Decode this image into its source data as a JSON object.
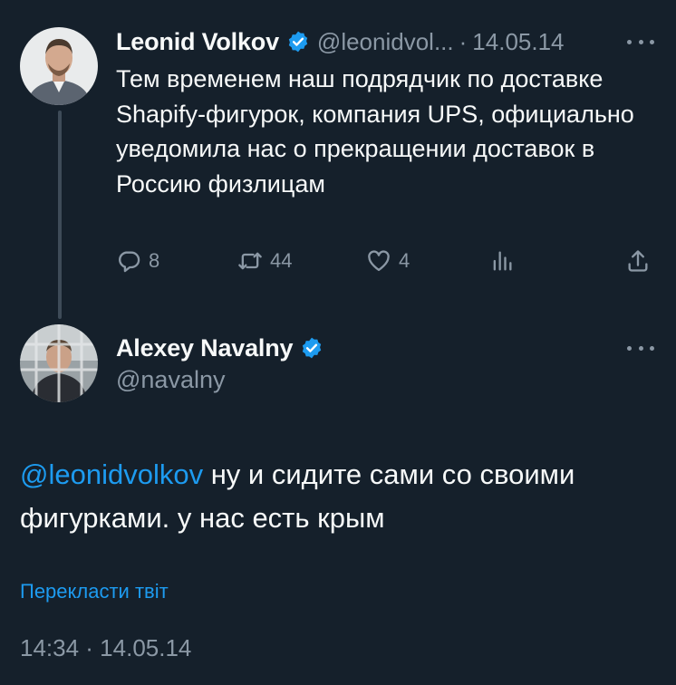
{
  "colors": {
    "background": "#15202b",
    "primary_text": "#f7f9f9",
    "secondary_text": "#8b98a5",
    "accent": "#1d9bf0",
    "thread_line": "#3e4b58"
  },
  "tweet1": {
    "author_name": "Leonid Volkov",
    "handle": "@leonidvol...",
    "separator": "·",
    "date": "14.05.14",
    "verified_icon": "verified-badge-icon",
    "text": "Тем временем наш подрядчик по доставке Shapify-фигурок, компания UPS, официально уведомила нас о прекращении доставок в Россию физлицам",
    "actions": {
      "reply_count": "8",
      "retweet_count": "44",
      "like_count": "4",
      "views_icon": "views-chart-icon",
      "share_icon": "share-icon"
    }
  },
  "tweet2": {
    "author_name": "Alexey Navalny",
    "handle": "@navalny",
    "verified_icon": "verified-badge-icon",
    "mention": "@leonidvolkov",
    "text": " ну и сидите сами со своими фигурками. у нас есть крым",
    "translate_label": "Перекласти твіт",
    "timestamp": "14:34 · 14.05.14"
  }
}
